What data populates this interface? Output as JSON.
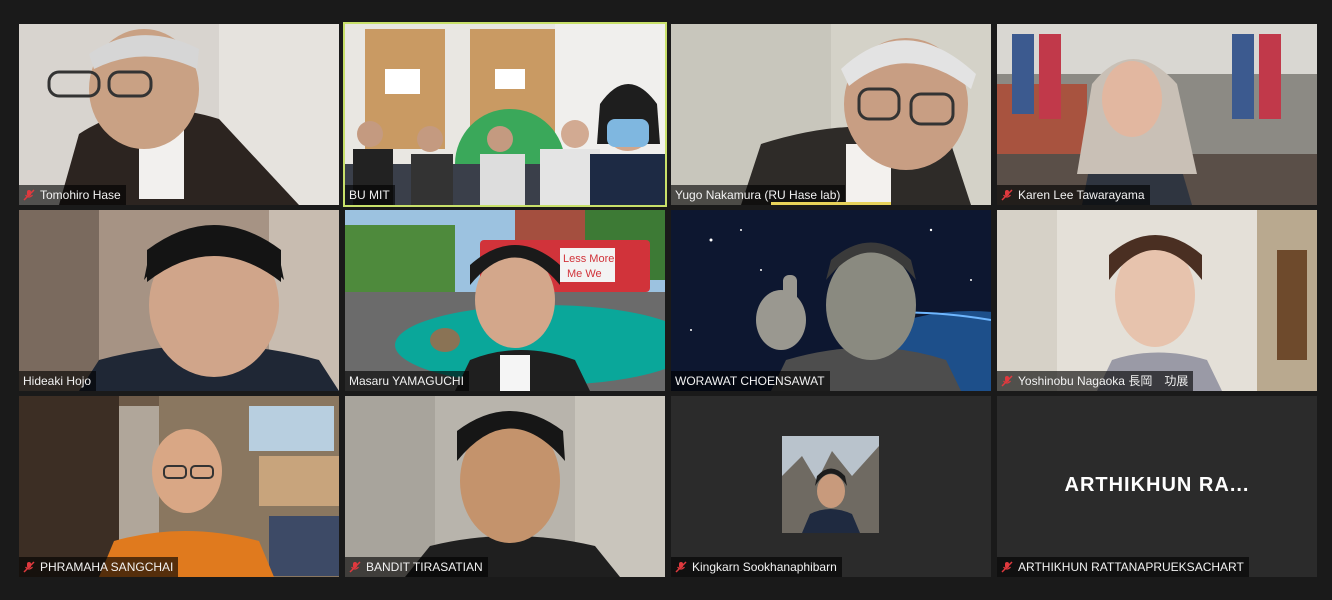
{
  "participants": [
    {
      "name": "Tomohiro Hase",
      "muted": true,
      "video": true
    },
    {
      "name": "BU MIT",
      "muted": false,
      "video": true,
      "active_speaker": true
    },
    {
      "name": "Yugo Nakamura (RU Hase lab)",
      "muted": false,
      "video": true
    },
    {
      "name": "Karen Lee Tawarayama",
      "muted": true,
      "video": true
    },
    {
      "name": "Hideaki Hojo",
      "muted": false,
      "video": true
    },
    {
      "name": "Masaru YAMAGUCHI",
      "muted": false,
      "video": true
    },
    {
      "name": "WORAWAT CHOENSAWAT",
      "muted": false,
      "video": true
    },
    {
      "name": "Yoshinobu Nagaoka 長岡　功展",
      "muted": true,
      "video": true
    },
    {
      "name": "PHRAMAHA SANGCHAI",
      "muted": true,
      "video": true
    },
    {
      "name": "BANDIT TIRASATIAN",
      "muted": true,
      "video": true
    },
    {
      "name": "Kingkarn Sookhanaphibarn",
      "muted": true,
      "video": false,
      "profile_picture": true
    },
    {
      "name": "ARTHIKHUN RATTANAPRUEKSACHART",
      "muted": true,
      "video": false,
      "display_name_truncated": "ARTHIKHUN  RA..."
    }
  ],
  "scene_text": {
    "bus_sign_line1": "Less More",
    "bus_sign_line2": "Me We"
  },
  "colors": {
    "background": "#1a1a1a",
    "active_speaker_border": "#c8e06a",
    "mute_icon": "#e0393e",
    "speaking_indicator": "#e8d35a"
  },
  "icons": {
    "muted": "microphone-muted-icon"
  }
}
